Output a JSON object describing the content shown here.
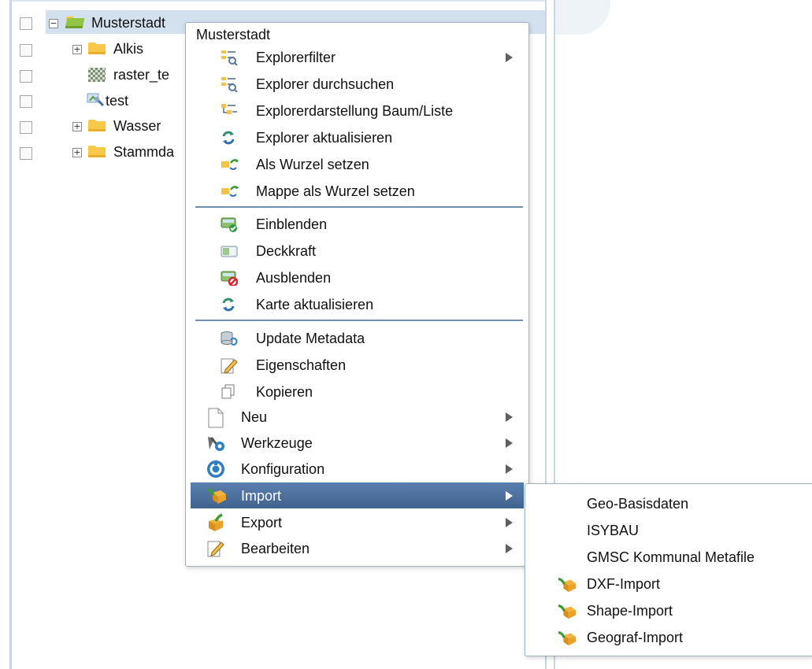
{
  "tree": {
    "root": {
      "label": "Musterstadt"
    },
    "items": [
      {
        "label": "Alkis"
      },
      {
        "label": "raster_te"
      },
      {
        "label": "test"
      },
      {
        "label": "Wasser"
      },
      {
        "label": "Stammda"
      }
    ]
  },
  "context_menu": {
    "header": "Musterstadt",
    "items": [
      {
        "label": "Explorerfilter",
        "icon": "explorer-filter-icon",
        "submenu": true
      },
      {
        "label": "Explorer durchsuchen",
        "icon": "explorer-search-icon"
      },
      {
        "label": "Explorerdarstellung Baum/Liste",
        "icon": "tree-list-icon"
      },
      {
        "label": "Explorer aktualisieren",
        "icon": "refresh-icon"
      },
      {
        "label": "Als Wurzel setzen",
        "icon": "set-root-icon"
      },
      {
        "label": "Mappe als Wurzel setzen",
        "icon": "folder-root-icon"
      },
      {
        "label": "Einblenden",
        "icon": "show-layer-icon"
      },
      {
        "label": "Deckkraft",
        "icon": "opacity-icon"
      },
      {
        "label": "Ausblenden",
        "icon": "hide-layer-icon"
      },
      {
        "label": "Karte aktualisieren",
        "icon": "refresh-map-icon"
      },
      {
        "label": "Update Metadata",
        "icon": "database-update-icon"
      },
      {
        "label": "Eigenschaften",
        "icon": "properties-icon"
      },
      {
        "label": "Kopieren",
        "icon": "copy-icon"
      },
      {
        "label": "Neu",
        "icon": "new-document-icon",
        "submenu": true
      },
      {
        "label": "Werkzeuge",
        "icon": "tools-icon",
        "submenu": true
      },
      {
        "label": "Konfiguration",
        "icon": "configuration-icon",
        "submenu": true
      },
      {
        "label": "Import",
        "icon": "import-icon",
        "submenu": true,
        "active": true
      },
      {
        "label": "Export",
        "icon": "export-icon",
        "submenu": true
      },
      {
        "label": "Bearbeiten",
        "icon": "edit-icon",
        "submenu": true
      }
    ]
  },
  "import_submenu": {
    "items": [
      {
        "label": "Geo-Basisdaten"
      },
      {
        "label": "ISYBAU"
      },
      {
        "label": "GMSC Kommunal Metafile"
      },
      {
        "label": "DXF-Import",
        "icon": "import-icon"
      },
      {
        "label": "Shape-Import",
        "icon": "import-icon"
      },
      {
        "label": "Geograf-Import",
        "icon": "import-icon"
      }
    ]
  },
  "colors": {
    "accent": "#4c6f9c",
    "selection": "#d3e1ee",
    "separator": "#6f8fae",
    "folder": "#f9c84a",
    "folder_open": "#94c445"
  }
}
